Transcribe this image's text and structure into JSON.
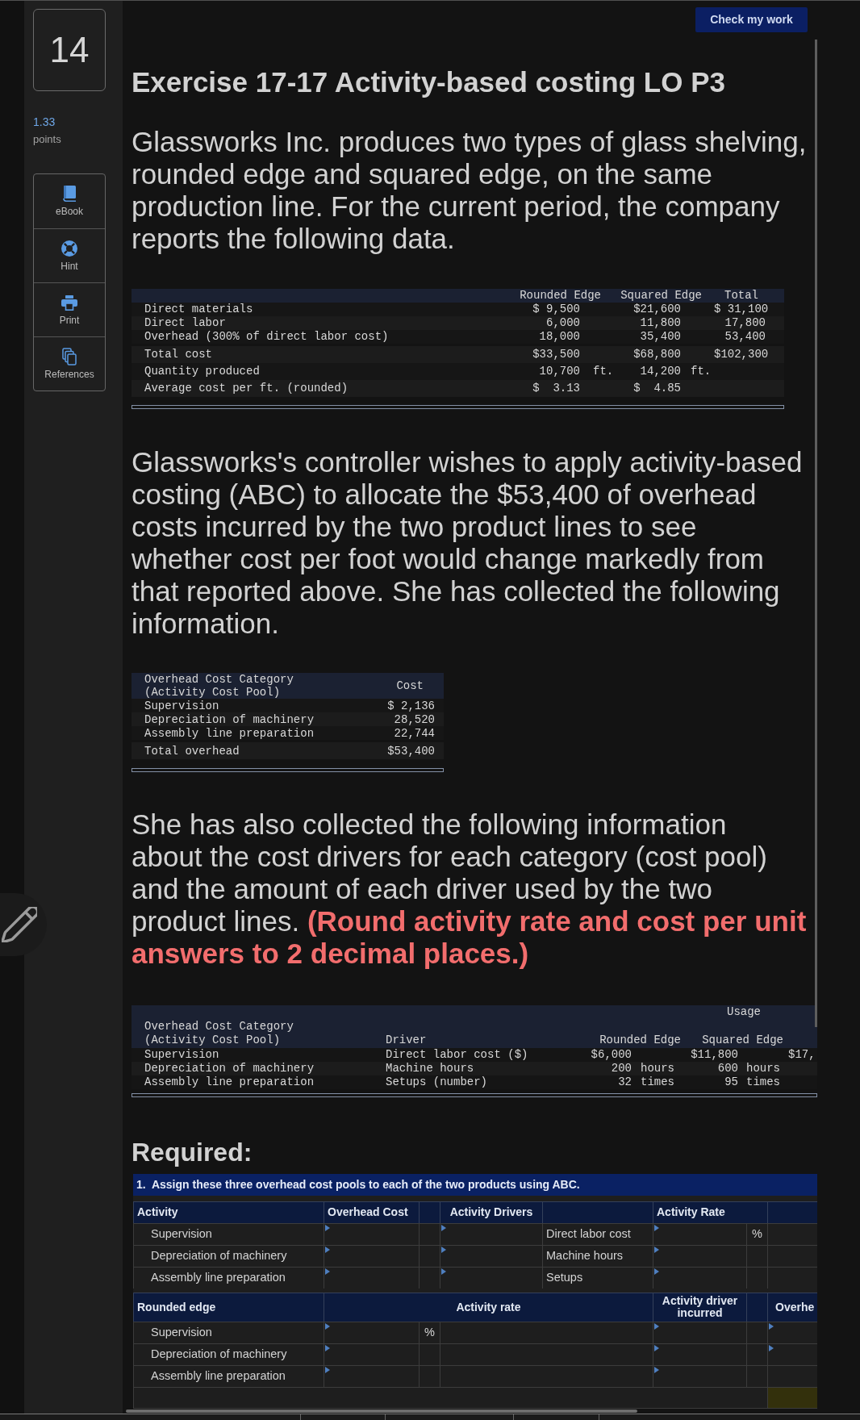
{
  "question": {
    "number": "14",
    "points": "1.33",
    "points_label": "points"
  },
  "tools": [
    {
      "kind": "ebook",
      "label": "eBook"
    },
    {
      "kind": "hint",
      "label": "Hint"
    },
    {
      "kind": "print",
      "label": "Print"
    },
    {
      "kind": "references",
      "label": "References"
    }
  ],
  "check_button": "Check my work",
  "title": "Exercise 17-17 Activity-based costing LO P3",
  "intro": {
    "lines": [
      "Glassworks Inc. produces two types of glass shelving,",
      "rounded edge and squared edge, on the same",
      "production line. For the current period, the company",
      "reports the following data."
    ]
  },
  "cost_table": {
    "columns": [
      "Rounded Edge",
      "Squared Edge",
      "Total"
    ],
    "rows": [
      {
        "kind": "detail",
        "label": "Direct materials",
        "rounded": "$ 9,500",
        "squared": "$21,600",
        "total": "$ 31,100"
      },
      {
        "kind": "detail",
        "label": "Direct labor",
        "rounded": "6,000",
        "squared": "11,800",
        "total": "17,800"
      },
      {
        "kind": "detail",
        "label": "Overhead (300% of direct labor cost)",
        "rounded": "18,000",
        "squared": "35,400",
        "total": "53,400"
      },
      {
        "kind": "summary",
        "label": "Total cost",
        "rounded": "$33,500",
        "squared": "$68,800",
        "total": "$102,300"
      },
      {
        "kind": "summary",
        "label": "Quantity produced",
        "rounded": "10,700",
        "rounded_unit": "ft.",
        "squared": "14,200",
        "squared_unit": "ft."
      },
      {
        "kind": "summary",
        "label": "Average cost per ft. (rounded)",
        "rounded": "$  3.13",
        "squared": "$  4.85"
      }
    ]
  },
  "paragraph_2": {
    "lines": [
      "Glassworks's controller wishes to apply activity-based",
      "costing (ABC) to allocate the $53,400 of overhead",
      "costs incurred by the two product lines to see",
      "whether cost per foot would change markedly from",
      "that reported above. She has collected the following",
      "information."
    ]
  },
  "pool_table": {
    "category": "Overhead Cost Category (Activity Cost Pool)",
    "cost": "Cost",
    "rows": [
      {
        "kind": "detail",
        "label": "Supervision",
        "cost": "$ 2,136"
      },
      {
        "kind": "detail",
        "label": "Depreciation of machinery",
        "cost": "28,520"
      },
      {
        "kind": "detail",
        "label": "Assembly line preparation",
        "cost": "22,744"
      },
      {
        "kind": "summary",
        "label": "Total overhead",
        "cost": "$53,400"
      }
    ]
  },
  "paragraph_3": {
    "lines": [
      "She has also collected the following information",
      "about the cost drivers for each category (cost pool)",
      "and the amount of each driver used by the two",
      "product lines. **(Round activity rate and cost per unit**",
      "**answers to 2 decimal places.)**"
    ]
  },
  "driver_table": {
    "group": "Usage",
    "category": "Overhead Cost Category (Activity Cost Pool)",
    "driver": "Driver",
    "columns": [
      "Rounded Edge",
      "Squared Edge"
    ],
    "rows": [
      {
        "label": "Supervision",
        "driver": "Direct labor cost ($)",
        "rounded": "$6,000",
        "squared": "$11,800",
        "column_3": "$17,"
      },
      {
        "label": "Depreciation of machinery",
        "driver": "Machine hours",
        "rounded": "200",
        "rounded_unit": "hours",
        "squared": "600",
        "squared_unit": "hours"
      },
      {
        "label": "Assembly line preparation",
        "driver": "Setups (number)",
        "rounded": "32",
        "rounded_unit": "times",
        "squared": "95",
        "squared_unit": "times"
      }
    ]
  },
  "required": "Required:",
  "part_1": {
    "instruction": "1.  Assign these three overhead cost pools to each of the two products using ABC.",
    "columns": {
      "activity": "Activity",
      "overhead_cost": "Overhead Cost",
      "drivers": "Activity Drivers",
      "rate": "Activity Rate"
    },
    "rows": [
      {
        "activity": "Supervision",
        "driver": "Direct labor cost",
        "rate_unit": "%"
      },
      {
        "activity": "Depreciation of machinery",
        "driver": "Machine hours"
      },
      {
        "activity": "Assembly line preparation",
        "driver": "Setups"
      }
    ]
  },
  "rounded_edge": {
    "columns": {
      "product": "Rounded edge",
      "rate": "Activity rate",
      "driver_incurred": "Activity driver incurred",
      "column_5": "Overhe"
    },
    "rows": [
      {
        "activity": "Supervision",
        "rate_unit": "%",
        "column_5_input": true
      },
      {
        "activity": "Depreciation of machinery",
        "column_5_input": true
      },
      {
        "activity": "Assembly line preparation",
        "column_5_input": false
      }
    ]
  }
}
